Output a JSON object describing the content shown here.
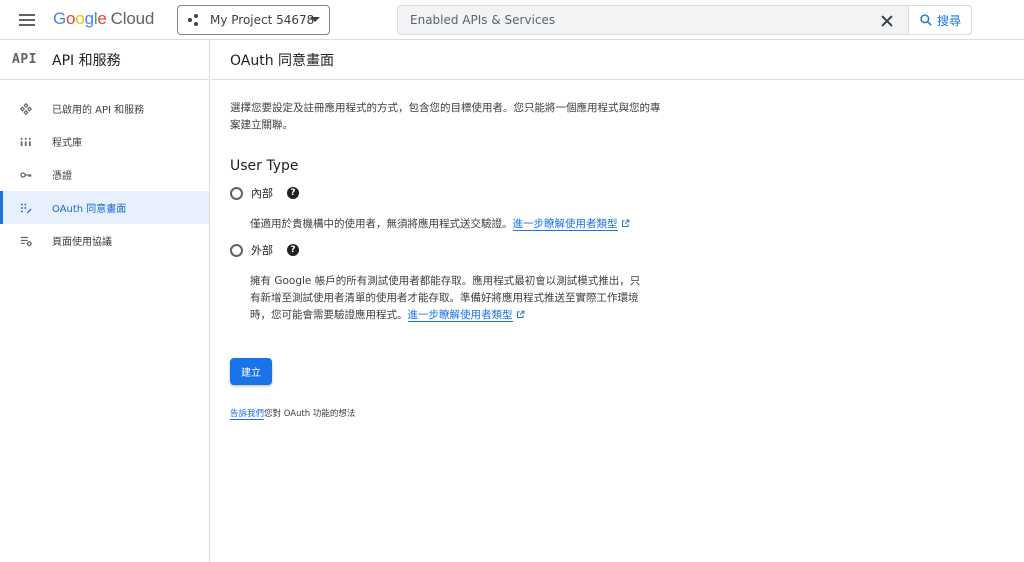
{
  "topbar": {
    "logo_parts": [
      "G",
      "o",
      "o",
      "g",
      "l",
      "e"
    ],
    "logo_suffix": "Cloud",
    "project_name": "My Project 54678",
    "search_value": "Enabled APIs & Services",
    "search_button_label": "搜尋"
  },
  "sidebar": {
    "api_mark": "API",
    "title": "API 和服務",
    "items": [
      {
        "label": "已啟用的 API 和服務",
        "icon": "enabled-apis-icon"
      },
      {
        "label": "程式庫",
        "icon": "library-icon"
      },
      {
        "label": "憑證",
        "icon": "key-icon"
      },
      {
        "label": "OAuth 同意畫面",
        "icon": "oauth-consent-icon",
        "active": true
      },
      {
        "label": "頁面使用協議",
        "icon": "page-usage-settings-icon"
      }
    ]
  },
  "main": {
    "title": "OAuth 同意畫面",
    "intro": "選擇您要設定及註冊應用程式的方式，包含您的目標使用者。您只能將一個應用程式與您的專案建立關聯。",
    "user_type_title": "User Type",
    "internal": {
      "label": "內部",
      "description": "僅適用於貴機構中的使用者，無須將應用程式送交驗證。",
      "link": "進一步瞭解使用者類型"
    },
    "external": {
      "label": "外部",
      "description": "擁有 Google 帳戶的所有測試使用者都能存取。應用程式最初會以測試模式推出，只有新增至測試使用者清單的使用者才能存取。準備好將應用程式推送至實際工作環境時，您可能會需要驗證應用程式。",
      "link": "進一步瞭解使用者類型"
    },
    "create_button": "建立",
    "feedback_link": "告訴我們",
    "feedback_text": "您對 OAuth 功能的想法",
    "help_glyph": "?"
  },
  "colors": {
    "accent": "#1a73e8",
    "active_bg": "#e8f0fe",
    "border": "#dadce0"
  }
}
